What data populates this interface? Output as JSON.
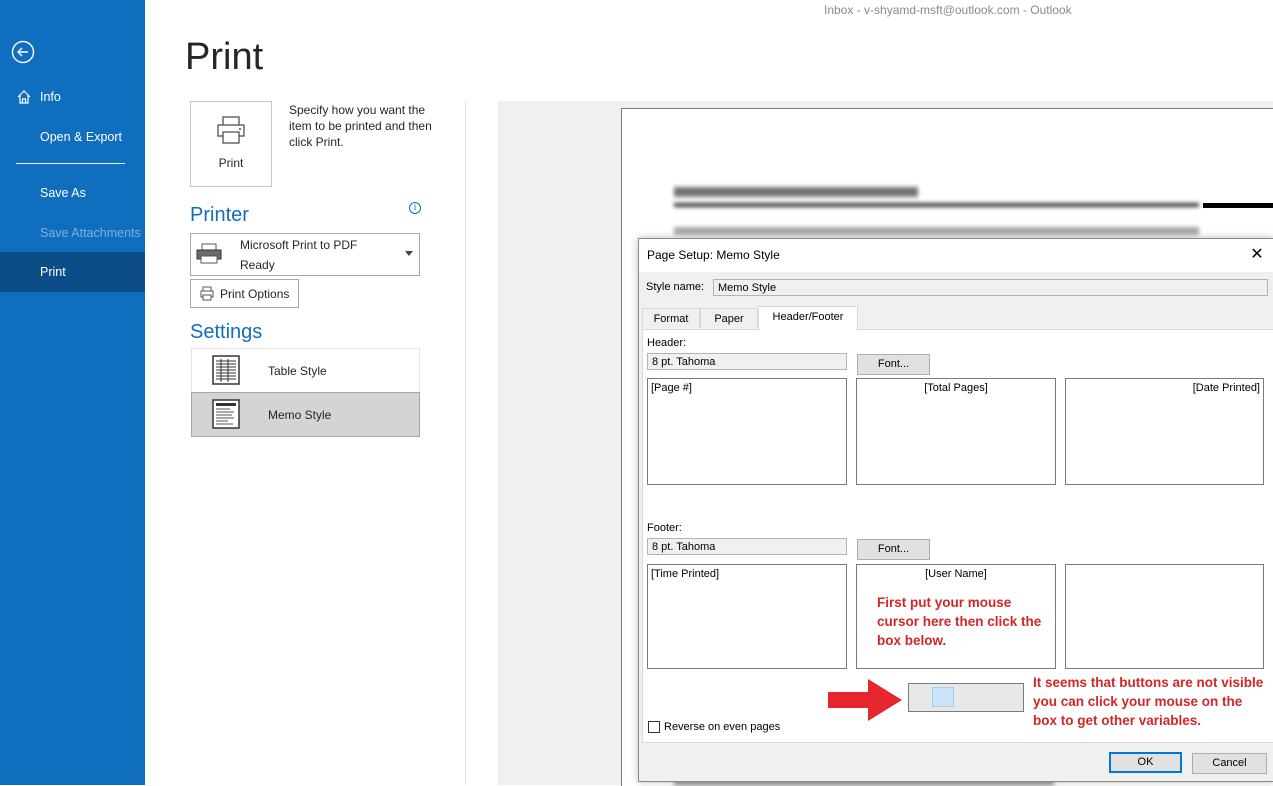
{
  "window": {
    "title": "Inbox - v-shyamd-msft@outlook.com  -  Outlook"
  },
  "nav": {
    "back_icon": "back-arrow-icon",
    "items": [
      {
        "label": "Info",
        "icon": "home-icon",
        "state": "normal"
      },
      {
        "label": "Open & Export",
        "state": "normal"
      },
      {
        "label": "Save As",
        "state": "normal"
      },
      {
        "label": "Save Attachments",
        "state": "disabled"
      },
      {
        "label": "Print",
        "state": "selected"
      }
    ]
  },
  "print": {
    "title": "Print",
    "print_button_label": "Print",
    "description": "Specify how you want the item to be printed and then click Print."
  },
  "printer": {
    "heading": "Printer",
    "name": "Microsoft Print to PDF",
    "status": "Ready",
    "options_label": "Print Options"
  },
  "settings": {
    "heading": "Settings",
    "styles": [
      {
        "label": "Table Style",
        "selected": false
      },
      {
        "label": "Memo Style",
        "selected": true
      }
    ]
  },
  "dialog": {
    "title": "Page Setup: Memo Style",
    "style_name_label": "Style name:",
    "style_name_value": "Memo Style",
    "tabs": [
      "Format",
      "Paper",
      "Header/Footer"
    ],
    "active_tab": "Header/Footer",
    "header": {
      "label": "Header:",
      "font_value": "8 pt. Tahoma",
      "font_button": "Font...",
      "left": "[Page #]",
      "center": "[Total Pages]",
      "right": "[Date Printed]"
    },
    "footer": {
      "label": "Footer:",
      "font_value": "8 pt. Tahoma",
      "font_button": "Font...",
      "left": "[Time Printed]",
      "center": "[User Name]",
      "right": ""
    },
    "reverse_label": "Reverse on even pages",
    "reverse_checked": false,
    "ok_label": "OK",
    "cancel_label": "Cancel"
  },
  "annotations": {
    "note1": "First put your mouse cursor here then click the box below.",
    "note2": "It seems that buttons are not visible you can click your mouse on the box to get other variables.",
    "color": "#d32626"
  },
  "colors": {
    "nav_bg": "#106ebe",
    "nav_selected": "#0c4d87",
    "accent": "#106ebe"
  }
}
